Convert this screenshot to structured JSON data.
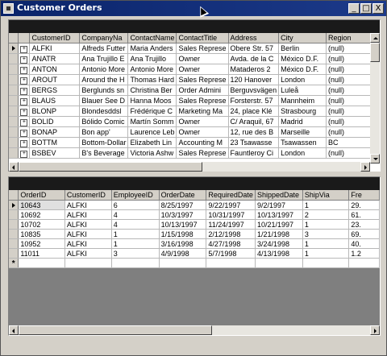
{
  "window": {
    "title": "Customer Orders",
    "controls": {
      "minimize": "_",
      "maximize": "□",
      "close": "X"
    }
  },
  "customers": {
    "columns": [
      "CustomerID",
      "CompanyNa",
      "ContactName",
      "ContactTitle",
      "Address",
      "City",
      "Region"
    ],
    "rows": [
      [
        "ALFKI",
        "Alfreds Futter",
        "Maria Anders",
        "Sales Represe",
        "Obere Str. 57",
        "Berlin",
        "(null)"
      ],
      [
        "ANATR",
        "Ana Trujillo E",
        "Ana Trujillo",
        "Owner",
        "Avda. de la C",
        "México D.F.",
        "(null)"
      ],
      [
        "ANTON",
        "Antonio More",
        "Antonio More",
        "Owner",
        "Mataderos 2",
        "México D.F.",
        "(null)"
      ],
      [
        "AROUT",
        "Around the H",
        "Thomas Hard",
        "Sales Represe",
        "120 Hanover",
        "London",
        "(null)"
      ],
      [
        "BERGS",
        "Berglunds sn",
        "Christina Ber",
        "Order Admini",
        "Berguvsvägen",
        "Luleå",
        "(null)"
      ],
      [
        "BLAUS",
        "Blauer See D",
        "Hanna Moos",
        "Sales Represe",
        "Forsterstr. 57",
        "Mannheim",
        "(null)"
      ],
      [
        "BLONP",
        "Blondesddsl",
        "Frédérique C",
        "Marketing Ma",
        "24, place Klé",
        "Strasbourg",
        "(null)"
      ],
      [
        "BOLID",
        "Bólido Comic",
        "Martín Somm",
        "Owner",
        "C/ Araquil, 67",
        "Madrid",
        "(null)"
      ],
      [
        "BONAP",
        "Bon app'",
        "Laurence Leb",
        "Owner",
        "12, rue des B",
        "Marseille",
        "(null)"
      ],
      [
        "BOTTM",
        "Bottom-Dollar",
        "Elizabeth Lin",
        "Accounting M",
        "23 Tsawasse",
        "Tsawassen",
        "BC"
      ],
      [
        "BSBEV",
        "B's Beverage",
        "Victoria Ashw",
        "Sales Represe",
        "Fauntleroy Ci",
        "London",
        "(null)"
      ]
    ]
  },
  "orders": {
    "columns": [
      "OrderID",
      "CustomerID",
      "EmployeeID",
      "OrderDate",
      "RequiredDate",
      "ShippedDate",
      "ShipVia",
      "Fre"
    ],
    "rows": [
      [
        "10643",
        "ALFKI",
        "6",
        "8/25/1997",
        "9/22/1997",
        "9/2/1997",
        "1",
        "29."
      ],
      [
        "10692",
        "ALFKI",
        "4",
        "10/3/1997",
        "10/31/1997",
        "10/13/1997",
        "2",
        "61."
      ],
      [
        "10702",
        "ALFKI",
        "4",
        "10/13/1997",
        "11/24/1997",
        "10/21/1997",
        "1",
        "23."
      ],
      [
        "10835",
        "ALFKI",
        "1",
        "1/15/1998",
        "2/12/1998",
        "1/21/1998",
        "3",
        "69."
      ],
      [
        "10952",
        "ALFKI",
        "1",
        "3/16/1998",
        "4/27/1998",
        "3/24/1998",
        "1",
        "40."
      ],
      [
        "11011",
        "ALFKI",
        "3",
        "4/9/1998",
        "5/7/1998",
        "4/13/1998",
        "1",
        "1.2"
      ]
    ],
    "new_row_marker": "*"
  }
}
